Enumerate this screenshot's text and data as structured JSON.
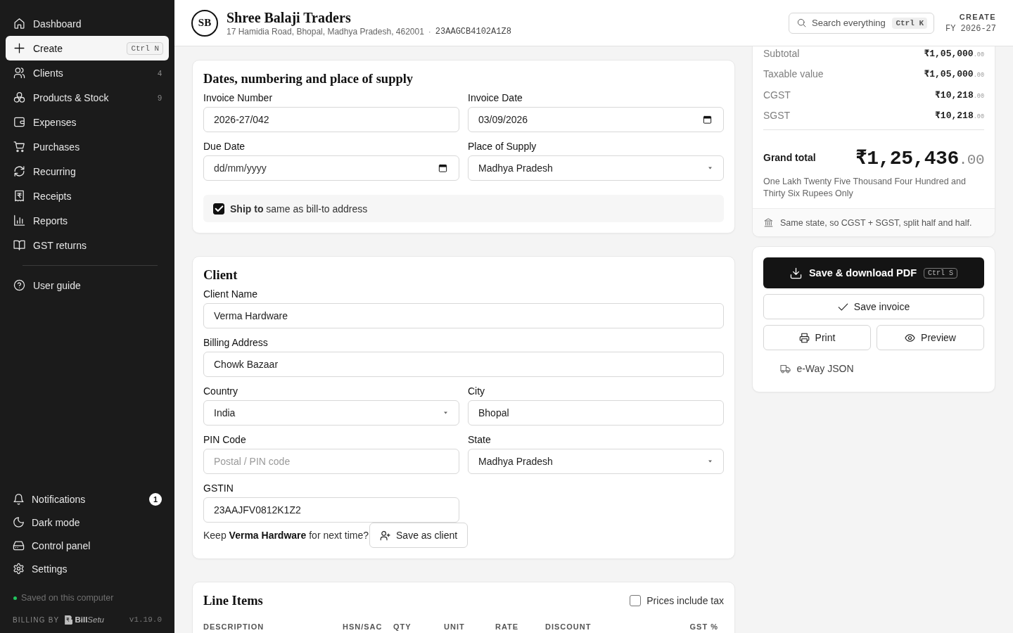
{
  "sidebar": {
    "nav": [
      {
        "label": "Dashboard",
        "selected": false
      },
      {
        "label": "Create",
        "selected": true,
        "shortcut": "Ctrl N"
      },
      {
        "label": "Clients",
        "selected": false,
        "count": "4"
      },
      {
        "label": "Products & Stock",
        "selected": false,
        "count": "9"
      },
      {
        "label": "Expenses",
        "selected": false
      },
      {
        "label": "Purchases",
        "selected": false
      },
      {
        "label": "Recurring",
        "selected": false
      },
      {
        "label": "Receipts",
        "selected": false
      },
      {
        "label": "Reports",
        "selected": false
      },
      {
        "label": "GST returns",
        "selected": false
      }
    ],
    "help": [
      {
        "label": "User guide"
      }
    ],
    "utilities": [
      {
        "label": "Notifications",
        "badge": "1"
      },
      {
        "label": "Dark mode"
      },
      {
        "label": "Control panel"
      },
      {
        "label": "Settings"
      }
    ],
    "storage_status": "Saved on this computer",
    "footer": {
      "credit": "BILLING BY",
      "brand": "**Bill**Setu",
      "version": "v1.19.0"
    }
  },
  "header": {
    "initials": "SB",
    "business_name": "Shree Balaji Traders",
    "address": "17 Hamidia Road, Bhopal, Madhya Pradesh, 462001",
    "separator": "·",
    "gstin": "23AAGCB4102A1Z8",
    "search": {
      "label": "Search everything",
      "shortcut": "Ctrl K"
    },
    "mode": "CREATE",
    "fiscal_year": "FY 2026-27"
  },
  "invoice_details": {
    "title": "Dates, numbering and place of supply",
    "fields": [
      {
        "label": "Invoice Number",
        "kind": "text",
        "value": "2026-27/042"
      },
      {
        "label": "Invoice Date",
        "kind": "date",
        "value": "03/09/2026"
      },
      {
        "label": "Due Date",
        "kind": "date",
        "placeholder": "dd/mm/yyyy"
      },
      {
        "label": "Place of Supply",
        "kind": "select",
        "value": "Madhya Pradesh"
      }
    ],
    "ship_to_same": {
      "label": "**Ship to** same as bill-to address",
      "checked": true
    }
  },
  "client": {
    "title": "Client",
    "fields": [
      {
        "label": "Client Name",
        "kind": "text",
        "value": "Verma Hardware",
        "wide": true
      },
      {
        "label": "Billing Address",
        "kind": "text",
        "value": "Chowk Bazaar",
        "wide": true
      },
      {
        "label": "Country",
        "kind": "select",
        "value": "India",
        "wide": false
      },
      {
        "label": "City",
        "kind": "text",
        "value": "Bhopal",
        "wide": false
      },
      {
        "label": "PIN Code",
        "kind": "text",
        "placeholder": "Postal / PIN code",
        "wide": false
      },
      {
        "label": "State",
        "kind": "select",
        "value": "Madhya Pradesh",
        "wide": false
      },
      {
        "label": "GSTIN",
        "kind": "text",
        "value": "23AAJFV0812K1Z2",
        "wide": false
      }
    ],
    "save_prompt": "Keep **Verma Hardware** for next time?",
    "save_button": "Save as client"
  },
  "line_items": {
    "title": "Line Items",
    "prices_include_tax": {
      "label": "Prices include tax",
      "checked": false
    },
    "columns": [
      "DESCRIPTION",
      "HSN/SAC",
      "QTY",
      "UNIT",
      "RATE",
      "DISCOUNT",
      "GST %"
    ]
  },
  "summary": {
    "rows": [
      {
        "label": "Subtotal",
        "amount": "₹1,05,000",
        "fraction": ".00"
      },
      {
        "label": "Taxable value",
        "amount": "₹1,05,000",
        "fraction": ".00"
      },
      {
        "label": "CGST",
        "amount": "₹10,218",
        "fraction": ".00"
      },
      {
        "label": "SGST",
        "amount": "₹10,218",
        "fraction": ".00"
      }
    ],
    "grand_total": {
      "label": "Grand total",
      "amount": "₹1,25,436",
      "fraction": ".00"
    },
    "amount_in_words": "One Lakh Twenty Five Thousand Four Hundred and Thirty Six Rupees Only",
    "tax_note": "Same state, so CGST + SGST, split half and half."
  },
  "actions": {
    "primary": {
      "label": "Save & download PDF",
      "shortcut": "Ctrl S"
    },
    "save": {
      "label": "Save invoice"
    },
    "secondary": [
      {
        "label": "Print"
      },
      {
        "label": "Preview"
      }
    ],
    "links": [
      {
        "label": "e-Way JSON"
      }
    ]
  }
}
